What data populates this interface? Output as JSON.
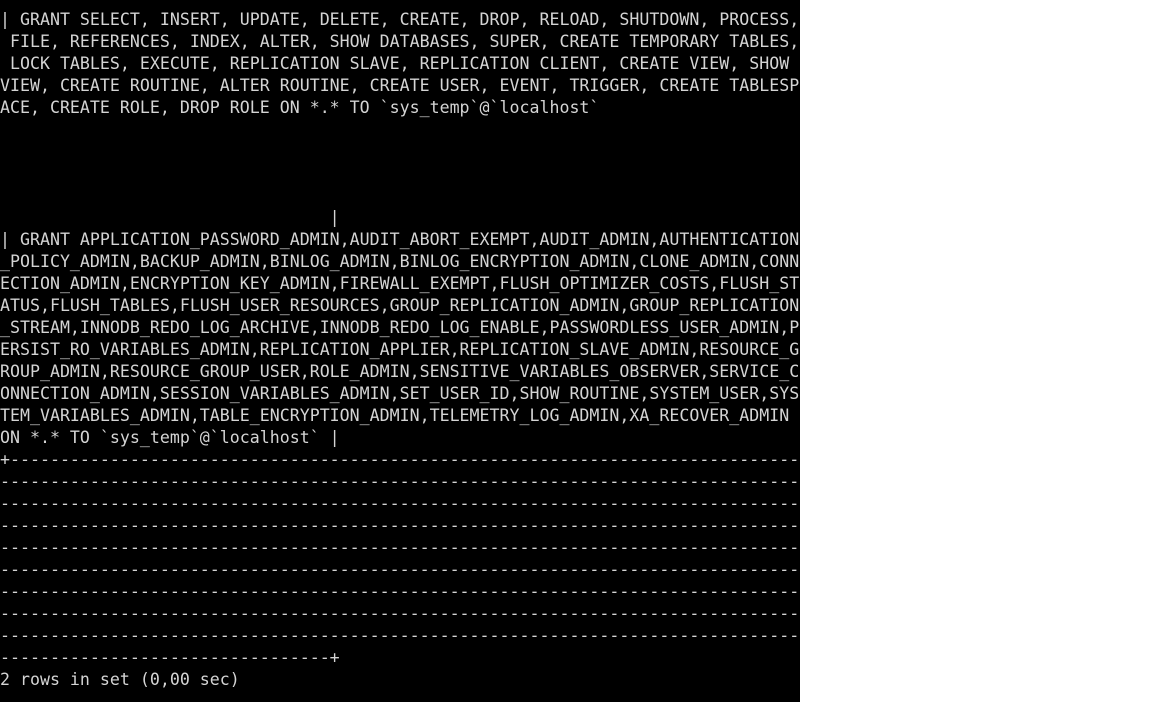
{
  "terminal": {
    "lines": [
      "| GRANT SELECT, INSERT, UPDATE, DELETE, CREATE, DROP, RELOAD, SHUTDOWN, PROCESS,",
      " FILE, REFERENCES, INDEX, ALTER, SHOW DATABASES, SUPER, CREATE TEMPORARY TABLES,",
      " LOCK TABLES, EXECUTE, REPLICATION SLAVE, REPLICATION CLIENT, CREATE VIEW, SHOW",
      "VIEW, CREATE ROUTINE, ALTER ROUTINE, CREATE USER, EVENT, TRIGGER, CREATE TABLESP",
      "ACE, CREATE ROLE, DROP ROLE ON *.* TO `sys_temp`@`localhost`",
      "",
      "",
      "",
      "",
      "                                 |",
      "| GRANT APPLICATION_PASSWORD_ADMIN,AUDIT_ABORT_EXEMPT,AUDIT_ADMIN,AUTHENTICATION",
      "_POLICY_ADMIN,BACKUP_ADMIN,BINLOG_ADMIN,BINLOG_ENCRYPTION_ADMIN,CLONE_ADMIN,CONN",
      "ECTION_ADMIN,ENCRYPTION_KEY_ADMIN,FIREWALL_EXEMPT,FLUSH_OPTIMIZER_COSTS,FLUSH_ST",
      "ATUS,FLUSH_TABLES,FLUSH_USER_RESOURCES,GROUP_REPLICATION_ADMIN,GROUP_REPLICATION",
      "_STREAM,INNODB_REDO_LOG_ARCHIVE,INNODB_REDO_LOG_ENABLE,PASSWORDLESS_USER_ADMIN,P",
      "ERSIST_RO_VARIABLES_ADMIN,REPLICATION_APPLIER,REPLICATION_SLAVE_ADMIN,RESOURCE_G",
      "ROUP_ADMIN,RESOURCE_GROUP_USER,ROLE_ADMIN,SENSITIVE_VARIABLES_OBSERVER,SERVICE_C",
      "ONNECTION_ADMIN,SESSION_VARIABLES_ADMIN,SET_USER_ID,SHOW_ROUTINE,SYSTEM_USER,SYS",
      "TEM_VARIABLES_ADMIN,TABLE_ENCRYPTION_ADMIN,TELEMETRY_LOG_ADMIN,XA_RECOVER_ADMIN",
      "ON *.* TO `sys_temp`@`localhost` |",
      "+-------------------------------------------------------------------------------",
      "--------------------------------------------------------------------------------",
      "--------------------------------------------------------------------------------",
      "--------------------------------------------------------------------------------",
      "--------------------------------------------------------------------------------",
      "--------------------------------------------------------------------------------",
      "--------------------------------------------------------------------------------",
      "--------------------------------------------------------------------------------",
      "--------------------------------------------------------------------------------",
      "---------------------------------+",
      "2 rows in set (0,00 sec)"
    ]
  }
}
